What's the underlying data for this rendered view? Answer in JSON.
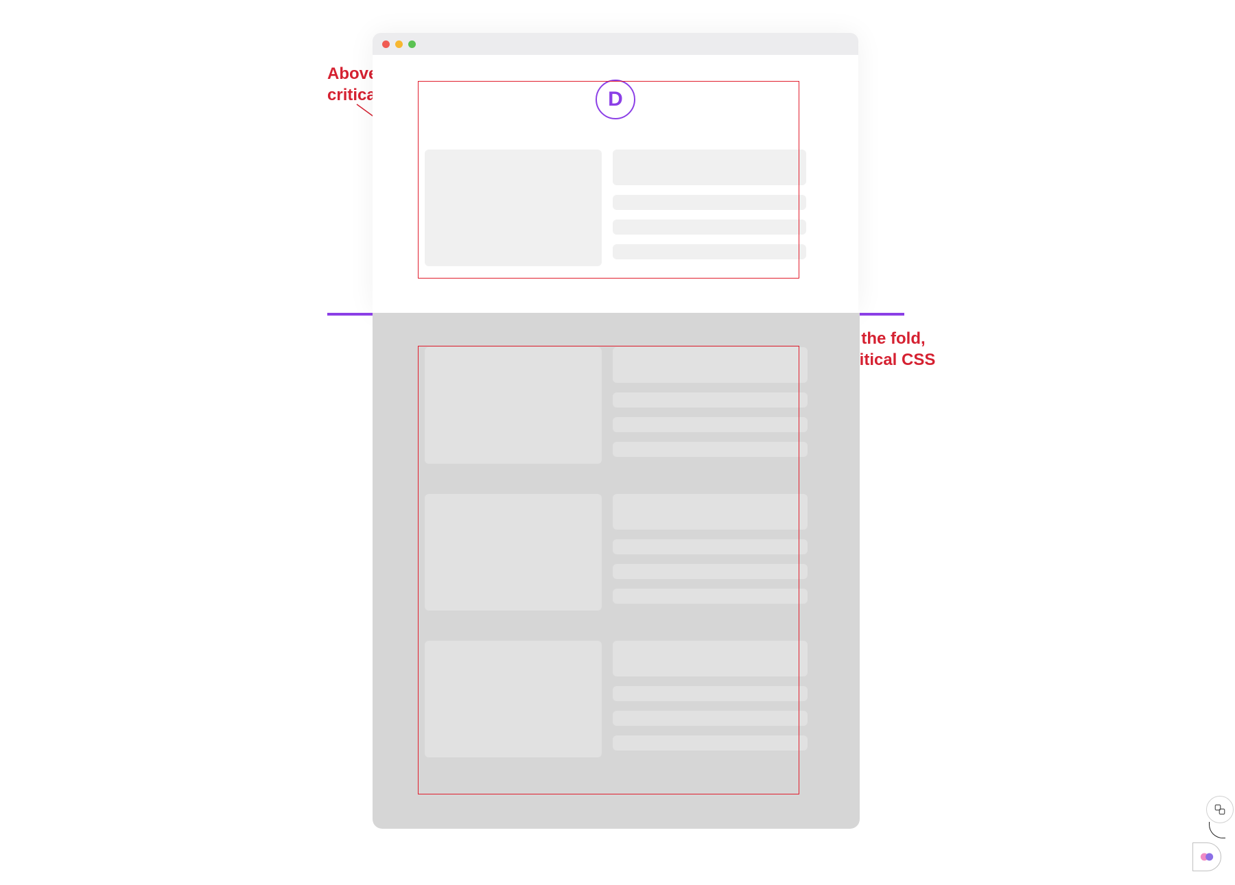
{
  "annotations": {
    "above": "Above the fold,\ncritical CSS",
    "below": "Below the fold,\nnon-critical CSS"
  },
  "logo": {
    "letter": "D"
  },
  "colors": {
    "accent_purple": "#8b3fe6",
    "annotation_red": "#d52131",
    "box_red": "#e11d2c",
    "below_fold_bg": "#d6d6d6",
    "placeholder_light": "#f0f0f0",
    "placeholder_dark": "#e1e1e1"
  },
  "traffic_lights": [
    "red",
    "yellow",
    "green"
  ],
  "rows_above_fold": 1,
  "rows_below_fold": 3
}
